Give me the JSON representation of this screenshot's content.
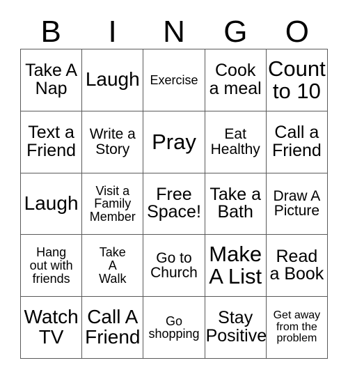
{
  "card": {
    "header_letters": [
      "B",
      "I",
      "N",
      "G",
      "O"
    ],
    "columns": 5,
    "rows": 5,
    "background_color": "#ffffff",
    "border_color": "#5a5a5a",
    "text_color": "#000000",
    "cells": [
      {
        "text": "Take A\nNap",
        "size": "md"
      },
      {
        "text": "Laugh",
        "size": "lg"
      },
      {
        "text": "Exercise",
        "size": "xs"
      },
      {
        "text": "Cook\na meal",
        "size": "md"
      },
      {
        "text": "Count\nto 10",
        "size": "xl"
      },
      {
        "text": "Text a\nFriend",
        "size": "md"
      },
      {
        "text": "Write a\nStory",
        "size": "sm"
      },
      {
        "text": "Pray",
        "size": "xl"
      },
      {
        "text": "Eat\nHealthy",
        "size": "sm"
      },
      {
        "text": "Call a\nFriend",
        "size": "md"
      },
      {
        "text": "Laugh",
        "size": "lg"
      },
      {
        "text": "Visit a\nFamily\nMember",
        "size": "xs"
      },
      {
        "text": "Free\nSpace!",
        "size": "md"
      },
      {
        "text": "Take a\nBath",
        "size": "md"
      },
      {
        "text": "Draw A\nPicture",
        "size": "sm"
      },
      {
        "text": "Hang\nout with\nfriends",
        "size": "xs"
      },
      {
        "text": "Take\nA\nWalk",
        "size": "xs"
      },
      {
        "text": "Go to\nChurch",
        "size": "sm"
      },
      {
        "text": "Make\nA List",
        "size": "xl"
      },
      {
        "text": "Read\na Book",
        "size": "md"
      },
      {
        "text": "Watch\nTV",
        "size": "lg"
      },
      {
        "text": "Call A\nFriend",
        "size": "lg"
      },
      {
        "text": "Go\nshopping",
        "size": "xs"
      },
      {
        "text": "Stay\nPositive",
        "size": "md"
      },
      {
        "text": "Get away\nfrom the\nproblem",
        "size": "xxs"
      }
    ]
  }
}
